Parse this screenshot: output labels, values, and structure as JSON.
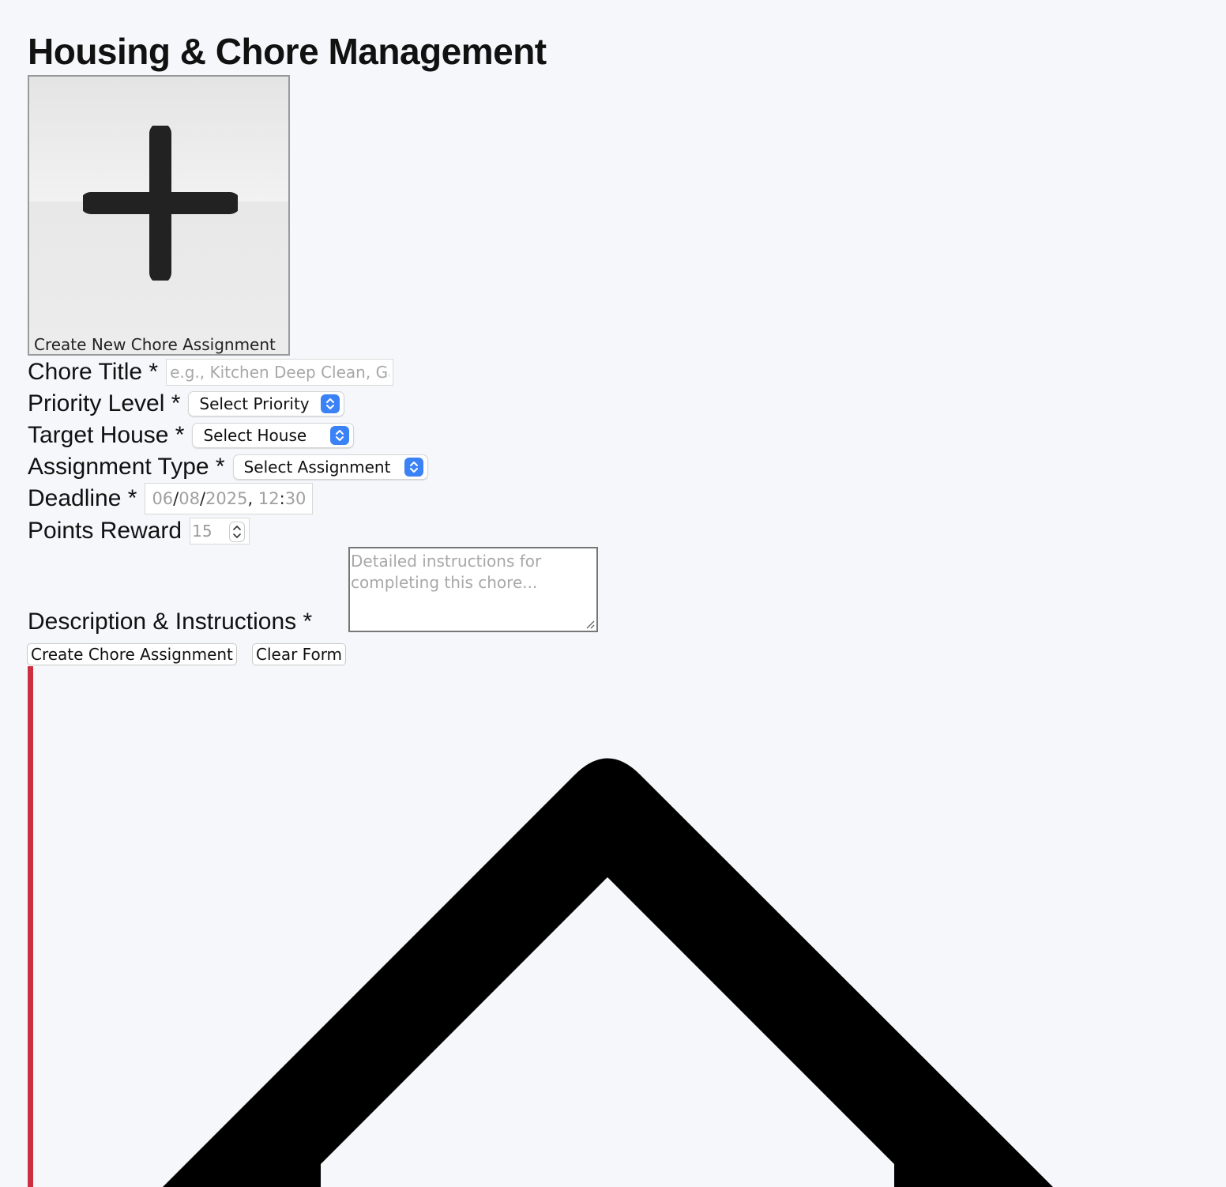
{
  "page": {
    "title": "Housing & Chore Management"
  },
  "create_card": {
    "label": "Create New Chore Assignment",
    "icon": "plus-icon"
  },
  "form": {
    "chore_title": {
      "label": "Chore Title *",
      "placeholder": "e.g., Kitchen Deep Clean, Garage Organization",
      "value": ""
    },
    "priority": {
      "label": "Priority Level *",
      "selected": "Select Priority"
    },
    "house": {
      "label": "Target House *",
      "selected": "Select House"
    },
    "assignment_type": {
      "label": "Assignment Type *",
      "selected": "Select Assignment"
    },
    "deadline": {
      "label": "Deadline *",
      "month": "06",
      "day": "08",
      "year": "2025",
      "hour": "12",
      "minute": "30"
    },
    "points": {
      "label": "Points Reward",
      "placeholder": "15"
    },
    "description": {
      "label": "Description & Instructions *",
      "placeholder": "Detailed instructions for completing this chore..."
    }
  },
  "buttons": {
    "submit_label": "Create Chore Assignment",
    "clear_label": "Clear Form"
  },
  "colors": {
    "accent_bar": "#cc2f3f",
    "select_arrow": "#3b82f6",
    "background": "#f5f7fa"
  },
  "decor": {
    "large_icon": "house-icon"
  }
}
